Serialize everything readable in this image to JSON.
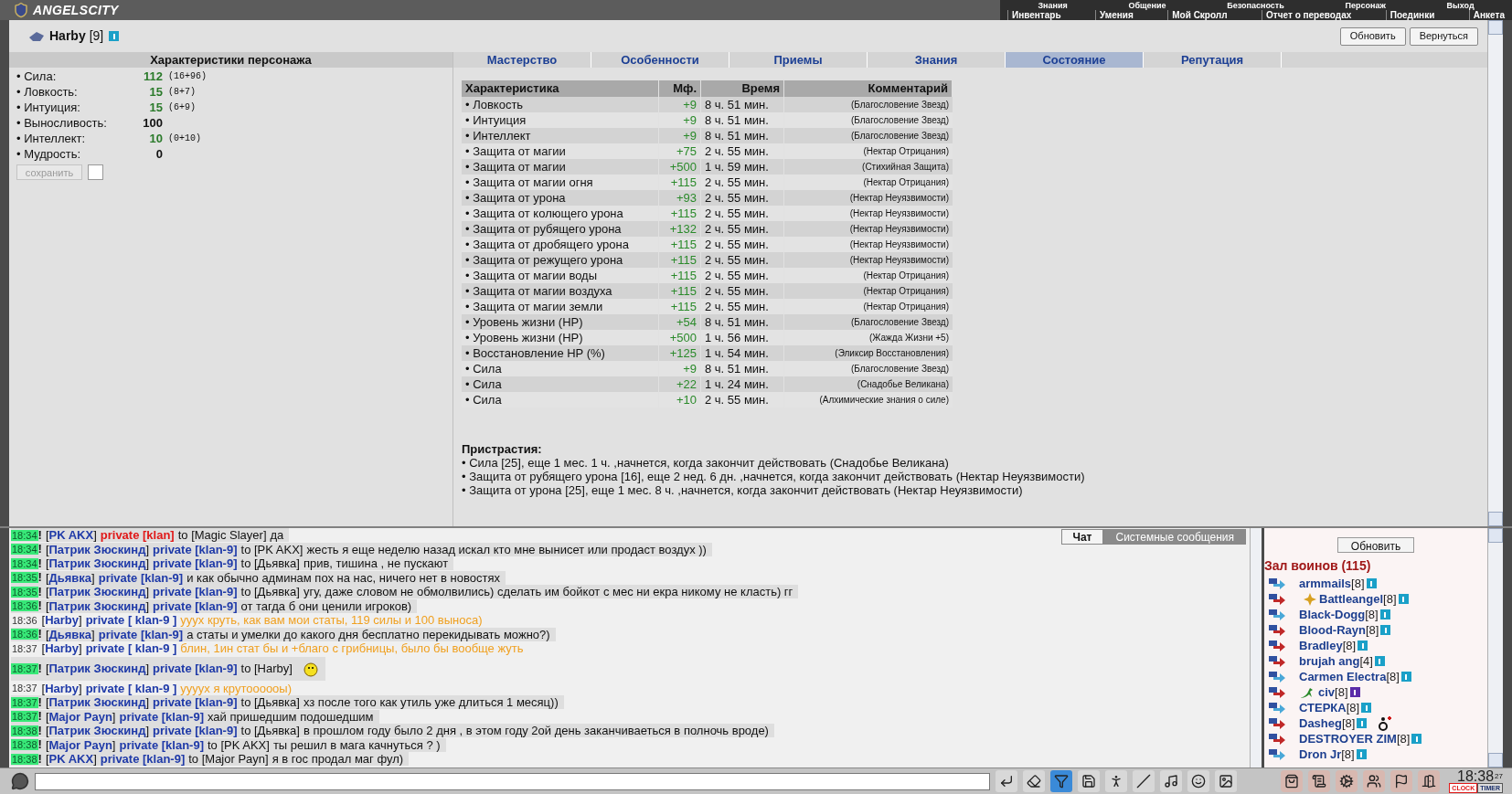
{
  "header": {
    "logo": "ANGELSCITY",
    "menu_top": [
      "Знания",
      "Общение",
      "Безопасность",
      "Персонаж",
      "Выход"
    ],
    "menu_bottom": [
      "Инвентарь",
      "Умения",
      "Мой Скролл",
      "Отчет о переводах",
      "Поединки",
      "Анкета"
    ]
  },
  "character": {
    "name": "Harby",
    "level": "[9]",
    "buttons": [
      "Обновить",
      "Вернуться"
    ]
  },
  "stats": {
    "title": "Характеристики персонажа",
    "items": [
      {
        "label": "• Сила:",
        "value": "112",
        "bonus": "(16+96)",
        "boosted": true
      },
      {
        "label": "• Ловкость:",
        "value": "15",
        "bonus": "(8+7)",
        "boosted": true
      },
      {
        "label": "• Интуиция:",
        "value": "15",
        "bonus": "(6+9)",
        "boosted": true
      },
      {
        "label": "• Выносливость:",
        "value": "100",
        "boosted": false
      },
      {
        "label": "• Интеллект:",
        "value": "10",
        "bonus": "(0+10)",
        "boosted": true
      },
      {
        "label": "• Мудрость:",
        "value": "0",
        "boosted": false
      }
    ],
    "save_button": {
      "label": "сохранить",
      "disabled": true
    },
    "checkbox": {
      "checked": false
    }
  },
  "tabs": [
    {
      "label": "Мастерство",
      "selected": false
    },
    {
      "label": "Особенности",
      "selected": false
    },
    {
      "label": "Приемы",
      "selected": false
    },
    {
      "label": "Знания",
      "selected": false
    },
    {
      "label": "Состояние",
      "selected": true
    },
    {
      "label": "Репутация",
      "selected": false
    }
  ],
  "effects": {
    "columns": [
      "Характеристика",
      "Мф.",
      "Время",
      "Комментарий"
    ],
    "rows": [
      {
        "name": "• Ловкость",
        "mf": "+9",
        "time": "8 ч. 51 мин.",
        "comment": "(Благословение Звезд)"
      },
      {
        "name": "• Интуиция",
        "mf": "+9",
        "time": "8 ч. 51 мин.",
        "comment": "(Благословение Звезд)"
      },
      {
        "name": "• Интеллект",
        "mf": "+9",
        "time": "8 ч. 51 мин.",
        "comment": "(Благословение Звезд)"
      },
      {
        "name": "• Защита от магии",
        "mf": "+75",
        "time": "2 ч. 55 мин.",
        "comment": "(Нектар Отрицания)"
      },
      {
        "name": "• Защита от магии",
        "mf": "+500",
        "time": "1 ч. 59 мин.",
        "comment": "(Стихийная Защита)"
      },
      {
        "name": "• Защита от магии огня",
        "mf": "+115",
        "time": "2 ч. 55 мин.",
        "comment": "(Нектар Отрицания)"
      },
      {
        "name": "• Защита от урона",
        "mf": "+93",
        "time": "2 ч. 55 мин.",
        "comment": "(Нектар Неуязвимости)"
      },
      {
        "name": "• Защита от колющего урона",
        "mf": "+115",
        "time": "2 ч. 55 мин.",
        "comment": "(Нектар Неуязвимости)"
      },
      {
        "name": "• Защита от рубящего урона",
        "mf": "+132",
        "time": "2 ч. 55 мин.",
        "comment": "(Нектар Неуязвимости)"
      },
      {
        "name": "• Защита от дробящего урона",
        "mf": "+115",
        "time": "2 ч. 55 мин.",
        "comment": "(Нектар Неуязвимости)"
      },
      {
        "name": "• Защита от режущего урона",
        "mf": "+115",
        "time": "2 ч. 55 мин.",
        "comment": "(Нектар Неуязвимости)"
      },
      {
        "name": "• Защита от магии воды",
        "mf": "+115",
        "time": "2 ч. 55 мин.",
        "comment": "(Нектар Отрицания)"
      },
      {
        "name": "• Защита от магии воздуха",
        "mf": "+115",
        "time": "2 ч. 55 мин.",
        "comment": "(Нектар Отрицания)"
      },
      {
        "name": "• Защита от магии земли",
        "mf": "+115",
        "time": "2 ч. 55 мин.",
        "comment": "(Нектар Отрицания)"
      },
      {
        "name": "• Уровень жизни (HP)",
        "mf": "+54",
        "time": "8 ч. 51 мин.",
        "comment": "(Благословение Звезд)"
      },
      {
        "name": "• Уровень жизни (HP)",
        "mf": "+500",
        "time": "1 ч. 56 мин.",
        "comment": "(Жажда Жизни +5)"
      },
      {
        "name": "• Восстановление HP (%)",
        "mf": "+125",
        "time": "1 ч. 54 мин.",
        "comment": "(Эликсир Восстановления)"
      },
      {
        "name": "• Сила",
        "mf": "+9",
        "time": "8 ч. 51 мин.",
        "comment": "(Благословение Звезд)"
      },
      {
        "name": "• Сила",
        "mf": "+22",
        "time": "1 ч. 24 мин.",
        "comment": "(Снадобье Великана)"
      },
      {
        "name": "• Сила",
        "mf": "+10",
        "time": "2 ч. 55 мин.",
        "comment": "(Алхимические знания о силе)"
      }
    ]
  },
  "addictions": {
    "title": "Пристрастия:",
    "items": [
      "• Сила [25], еще 1 мес. 1 ч. ,начнется, когда закончит действовать (Снадобье Великана)",
      "• Защита от рубящего урона [16], еще 2 нед. 6 дн. ,начнется, когда закончит действовать (Нектар Неуязвимости)",
      "• Защита от урона [25], еще 1 мес. 8 ч. ,начнется, когда закончит действовать (Нектар Неуязвимости)"
    ]
  },
  "chat_tabs": [
    {
      "label": "Чат",
      "selected": true
    },
    {
      "label": "Системные сообщения",
      "selected": false
    }
  ],
  "messages": [
    {
      "kind": "clan",
      "time": "18:34",
      "alert": true,
      "bang": "!",
      "sender": "[**PK AKX**]",
      "channel": "private [klan]",
      "to": "to [Magic Slayer]",
      "text": "да",
      "smiley": false
    },
    {
      "kind": "incoming",
      "time": "18:34",
      "alert": true,
      "bang": "!",
      "sender": "[**Патрик Зюскинд**]",
      "channel": "private [klan-9]",
      "to": "to [PK AKX]",
      "text": "жесть я еще неделю назад искал кто мне вынисет или продаст воздух ))",
      "smiley": false
    },
    {
      "kind": "incoming",
      "time": "18:34",
      "alert": true,
      "bang": "!",
      "sender": "[**Патрик Зюскинд**]",
      "channel": "private [klan-9]",
      "to": "to [Дьявка]",
      "text": "прив, тишина , не пускают",
      "smiley": false
    },
    {
      "kind": "incoming",
      "time": "18:35",
      "alert": true,
      "bang": "!",
      "sender": "[**Дьявка**]",
      "channel": "private [klan-9]",
      "text": "и как обычно админам пох на нас, ничего нет в новостях",
      "smiley": false
    },
    {
      "kind": "incoming",
      "time": "18:35",
      "alert": true,
      "bang": "!",
      "sender": "[**Патрик Зюскинд**]",
      "channel": "private [klan-9]",
      "to": "to [Дьявка]",
      "text": "угу, даже словом не обмолвились) сделать им бойкот с мес ни екра никому не класть) гг",
      "smiley": false
    },
    {
      "kind": "incoming",
      "time": "18:36",
      "alert": true,
      "bang": "!",
      "sender": "[**Патрик Зюскинд**]",
      "channel": "private [klan-9]",
      "text": "от тагда б они ценили игроков)",
      "smiley": false
    },
    {
      "kind": "outgoing",
      "time": "18:36",
      "alert": false,
      "sender": "[**Harby**]",
      "channel": "private [ klan-9 ]",
      "text": "ууух круть, как вам мои статы, 119 силы и 100 выноса)",
      "smiley": false
    },
    {
      "kind": "incoming",
      "time": "18:36",
      "alert": true,
      "bang": "!",
      "sender": "[**Дьявка**]",
      "channel": "private [klan-9]",
      "text": "а статы и умелки до какого дня бесплатно перекидывать можно?)",
      "smiley": false
    },
    {
      "kind": "outgoing",
      "time": "18:37",
      "alert": false,
      "sender": "[**Harby**]",
      "channel": "private [ klan-9 ]",
      "text": "блин, 1ин стат бы и +благо с грибницы, было бы вообще жуть",
      "smiley": false
    },
    {
      "kind": "incoming",
      "time": "18:37",
      "alert": true,
      "bang": "!",
      "sender": "[**Патрик Зюскинд**]",
      "channel": "private [klan-9]",
      "to": "to [Harby]",
      "smiley": true
    },
    {
      "kind": "outgoing",
      "time": "18:37",
      "alert": false,
      "sender": "[**Harby**]",
      "channel": "private [ klan-9 ]",
      "text": "уууух я крутоооооы)",
      "smiley": false
    },
    {
      "kind": "incoming",
      "time": "18:37",
      "alert": true,
      "bang": "!",
      "sender": "[**Патрик Зюскинд**]",
      "channel": "private [klan-9]",
      "to": "to [Дьявка]",
      "text": "хз после того как утиль уже длиться 1 месяц))",
      "smiley": false
    },
    {
      "kind": "incoming",
      "time": "18:37",
      "alert": true,
      "bang": "!",
      "sender": "[**Major Payn**]",
      "channel": "private [klan-9]",
      "text": "хай пришедшим подошедшим",
      "smiley": false
    },
    {
      "kind": "incoming",
      "time": "18:38",
      "alert": true,
      "bang": "!",
      "sender": "[**Патрик Зюскинд**]",
      "channel": "private [klan-9]",
      "to": "to [Дьявка]",
      "text": "в прошлом году было 2 дня , в этом году 2ой день заканчиваеться в полночь вроде)",
      "smiley": false
    },
    {
      "kind": "incoming",
      "time": "18:38",
      "alert": true,
      "bang": "!",
      "sender": "[**Major Payn**]",
      "channel": "private [klan-9]",
      "to": "to [PK AKX]",
      "text": "ты решил в мага качнуться ? )",
      "smiley": false
    },
    {
      "kind": "incoming",
      "time": "18:38",
      "alert": true,
      "bang": "!",
      "sender": "[**PK AKX**]",
      "channel": "private [klan-9]",
      "to": "to [Major Payn]",
      "text": "я в гос продал маг фул)",
      "smiley": false
    }
  ],
  "users": {
    "refresh_button": "Обновить",
    "title": "Зал воинов (115)",
    "items": [
      {
        "kind": "plain",
        "name": "armmails",
        "level": "[8]",
        "color": "#4aa8d8",
        "injured": false,
        "special": false
      },
      {
        "kind": "star",
        "name": "Battleangel",
        "level": "[8]",
        "color": "#c02828",
        "injured": false,
        "special": false
      },
      {
        "kind": "plain",
        "name": "Black-Dogg",
        "level": "[8]",
        "color": "#4aa8d8",
        "injured": false,
        "special": false
      },
      {
        "kind": "plain",
        "name": "Blood-Rayn",
        "level": "[8]",
        "color": "#c02828",
        "injured": false,
        "special": false
      },
      {
        "kind": "plain",
        "name": "Bradley",
        "level": "[8]",
        "color": "#c02828",
        "injured": false,
        "special": false
      },
      {
        "kind": "plain",
        "name": "brujah ang",
        "level": "[4]",
        "color": "#c02828",
        "injured": false,
        "special": false
      },
      {
        "kind": "plain",
        "name": "Carmen Electra",
        "level": "[8]",
        "color": "#4aa8d8",
        "injured": false,
        "special": false
      },
      {
        "kind": "lizard",
        "name": "civ",
        "level": "[8]",
        "color": "#c02828",
        "injured": false,
        "special": true
      },
      {
        "kind": "plain",
        "name": "СТЕРКА",
        "level": "[8]",
        "color": "#4aa8d8",
        "injured": false,
        "special": false
      },
      {
        "kind": "plain",
        "name": "Dasheg",
        "level": "[8]",
        "color": "#c02828",
        "injured": true,
        "special": false
      },
      {
        "kind": "plain",
        "name": "DESTROYER ZIM",
        "level": "[8]",
        "color": "#c02828",
        "injured": false,
        "special": false
      },
      {
        "kind": "plain",
        "name": "Dron Jr",
        "level": "[8]",
        "color": "#4aa8d8",
        "injured": false,
        "special": false
      }
    ]
  },
  "clock": {
    "time": "18:38",
    "seconds": "27",
    "modes": [
      {
        "label": "CLOCK",
        "selected": true
      },
      {
        "label": "TIMER",
        "selected": false
      }
    ]
  }
}
